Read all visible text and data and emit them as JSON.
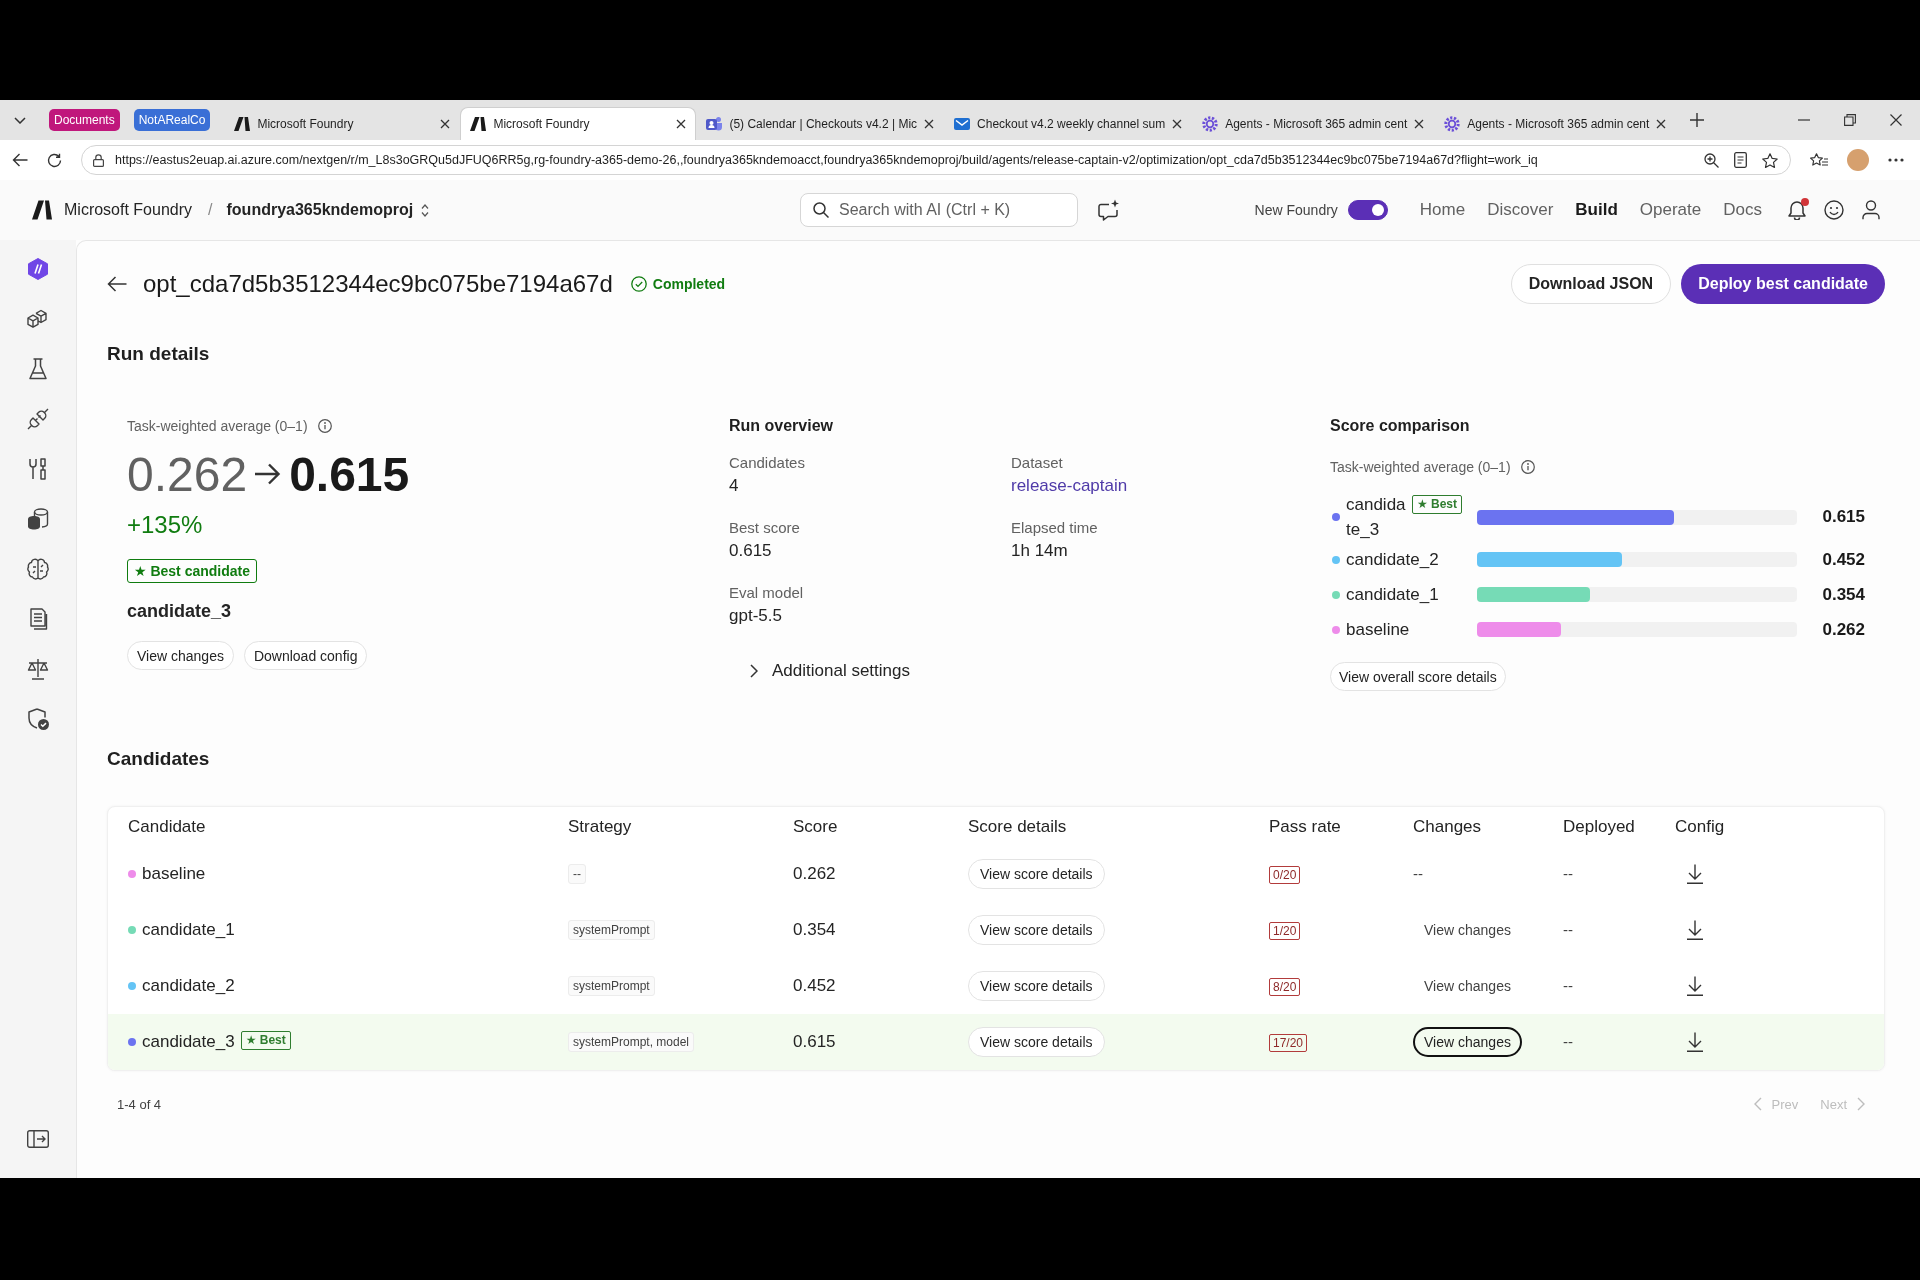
{
  "browser": {
    "tab_groups": [
      {
        "label": "Documents",
        "color": "#c0177c"
      },
      {
        "label": "NotARealCo",
        "color": "#3a6fd6"
      }
    ],
    "tabs": [
      {
        "title": "Microsoft Foundry",
        "kind": "logo",
        "selected": false
      },
      {
        "title": "Microsoft Foundry",
        "kind": "logo",
        "selected": true
      },
      {
        "title": "(5) Calendar | Checkouts v4.2 | Mic",
        "kind": "people",
        "selected": false
      },
      {
        "title": "Checkout v4.2 weekly channel sum",
        "kind": "mail",
        "selected": false
      },
      {
        "title": "Agents - Microsoft 365 admin cent",
        "kind": "gear",
        "selected": false
      },
      {
        "title": "Agents - Microsoft 365 admin cent",
        "kind": "gear",
        "selected": false
      }
    ],
    "url": "https://eastus2euap.ai.azure.com/nextgen/r/m_L8s3oGRQu5dJFUQ6RR5g,rg-foundry-a365-demo-26,,foundrya365kndemoacct,foundrya365kndemoproj/build/agents/release-captain-v2/optimization/opt_cda7d5b3512344ec9bc075be7194a67d?flight=work_iq"
  },
  "header": {
    "brand": "Microsoft Foundry",
    "separator": "/",
    "project": "foundrya365kndemoproj",
    "search": {
      "placeholder": "Search with AI (Ctrl + K)"
    },
    "toggle": {
      "label": "New Foundry",
      "on": true
    },
    "nav": [
      {
        "label": "Home",
        "selected": false
      },
      {
        "label": "Discover",
        "selected": false
      },
      {
        "label": "Build",
        "selected": true
      },
      {
        "label": "Operate",
        "selected": false
      },
      {
        "label": "Docs",
        "selected": false
      }
    ],
    "notifications_unread": true
  },
  "page": {
    "title": "opt_cda7d5b3512344ec9bc075be7194a67d",
    "status": "Completed",
    "actions": [
      {
        "label": "Download JSON",
        "kind": "secondary"
      },
      {
        "label": "Deploy best candidate",
        "kind": "primary"
      }
    ]
  },
  "run_details": {
    "heading": "Run details",
    "summary": {
      "metric_label": "Task-weighted average (0–1)",
      "from": "0.262",
      "to": "0.615",
      "delta": "+135%",
      "badge": "★ Best candidate",
      "candidate": "candidate_3",
      "buttons": [
        "View changes",
        "Download config"
      ]
    },
    "overview": {
      "heading": "Run overview",
      "fields": [
        {
          "label": "Candidates",
          "value": "4",
          "kind": "text"
        },
        {
          "label": "Dataset",
          "value": "release-captain",
          "kind": "link"
        },
        {
          "label": "Best score",
          "value": "0.615",
          "kind": "text"
        },
        {
          "label": "Elapsed time",
          "value": "1h 14m",
          "kind": "text"
        },
        {
          "label": "Eval model",
          "value": "gpt-5.5",
          "kind": "text"
        }
      ],
      "additional_settings": {
        "label": "Additional settings",
        "expanded": false
      }
    },
    "score_comparison": {
      "heading": "Score comparison",
      "metric_label": "Task-weighted average (0–1)",
      "rows": [
        {
          "name": "candidate_3",
          "color": "#6b73f0",
          "badge": "★ Best",
          "level": 0.615,
          "value": "0.615"
        },
        {
          "name": "candidate_2",
          "color": "#64c4f5",
          "level": 0.452,
          "value": "0.452"
        },
        {
          "name": "candidate_1",
          "color": "#76dbb6",
          "level": 0.354,
          "value": "0.354"
        },
        {
          "name": "baseline",
          "color": "#ee8cea",
          "level": 0.262,
          "value": "0.262"
        }
      ],
      "button": "View overall score details"
    }
  },
  "candidates": {
    "heading": "Candidates",
    "columns": [
      "Candidate",
      "Strategy",
      "Score",
      "Score details",
      "Pass rate",
      "Changes",
      "Deployed",
      "Config"
    ],
    "rows": [
      {
        "name": "baseline",
        "color": "#ee8cea",
        "highlighted": false,
        "strategy": "--",
        "score": "0.262",
        "score_details": "View score details",
        "pass_rate": "0/20",
        "changes": {
          "kind": "text",
          "text": "--"
        },
        "deployed": "--"
      },
      {
        "name": "candidate_1",
        "color": "#76dbb6",
        "highlighted": false,
        "strategy": "systemPrompt",
        "score": "0.354",
        "score_details": "View score details",
        "pass_rate": "1/20",
        "changes": {
          "kind": "button",
          "label": "View changes",
          "focused": false
        },
        "deployed": "--"
      },
      {
        "name": "candidate_2",
        "color": "#64c4f5",
        "highlighted": false,
        "strategy": "systemPrompt",
        "score": "0.452",
        "score_details": "View score details",
        "pass_rate": "8/20",
        "changes": {
          "kind": "button",
          "label": "View changes",
          "focused": false
        },
        "deployed": "--"
      },
      {
        "name": "candidate_3",
        "color": "#6b73f0",
        "badge": "★ Best",
        "highlighted": true,
        "strategy": "systemPrompt, model",
        "score": "0.615",
        "score_details": "View score details",
        "pass_rate": "17/20",
        "changes": {
          "kind": "button",
          "label": "View changes",
          "focused": true
        },
        "deployed": "--"
      }
    ],
    "pagination": {
      "summary": "1-4 of 4",
      "prev": {
        "label": "Prev",
        "disabled": true
      },
      "next": {
        "label": "Next",
        "disabled": true
      }
    }
  }
}
